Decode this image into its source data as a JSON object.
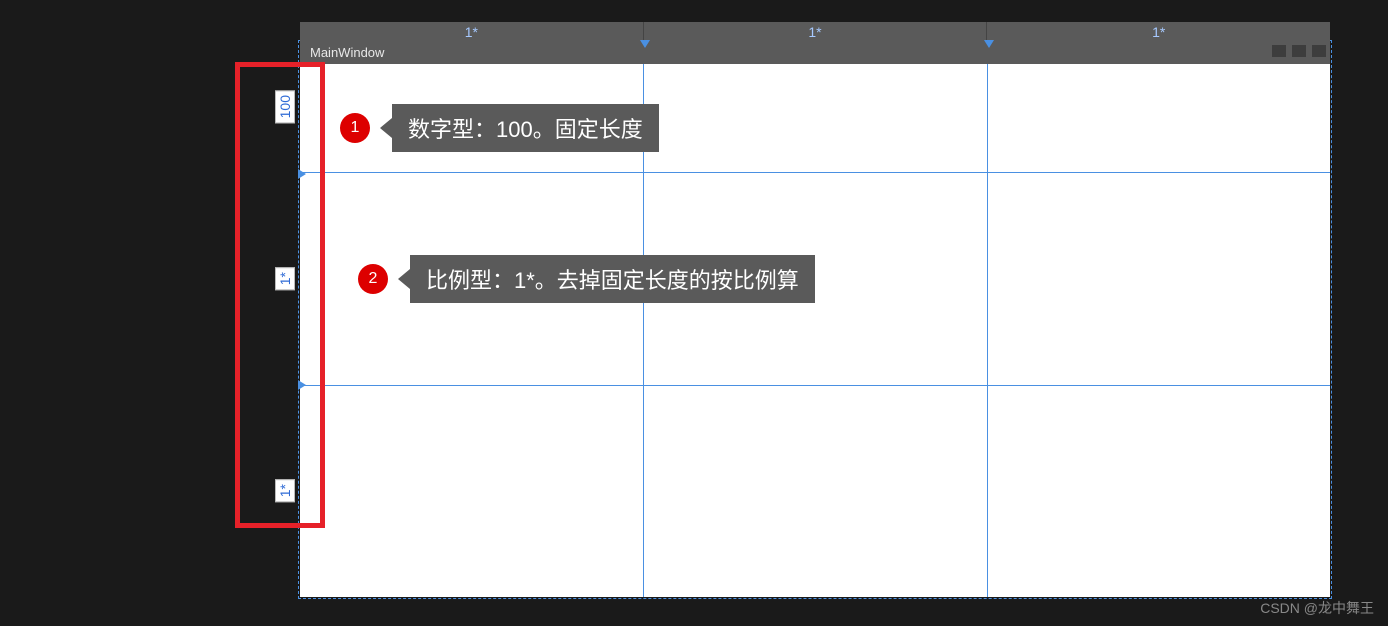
{
  "window": {
    "title": "MainWindow"
  },
  "columns": [
    {
      "width": "1*"
    },
    {
      "width": "1*"
    },
    {
      "width": "1*"
    }
  ],
  "rows": [
    {
      "height": "100"
    },
    {
      "height": "1*"
    },
    {
      "height": "1*"
    }
  ],
  "callouts": [
    {
      "num": "1",
      "text": "数字型：100。固定长度"
    },
    {
      "num": "2",
      "text": "比例型：1*。去掉固定长度的按比例算"
    }
  ],
  "watermark": "CSDN @龙中舞王"
}
